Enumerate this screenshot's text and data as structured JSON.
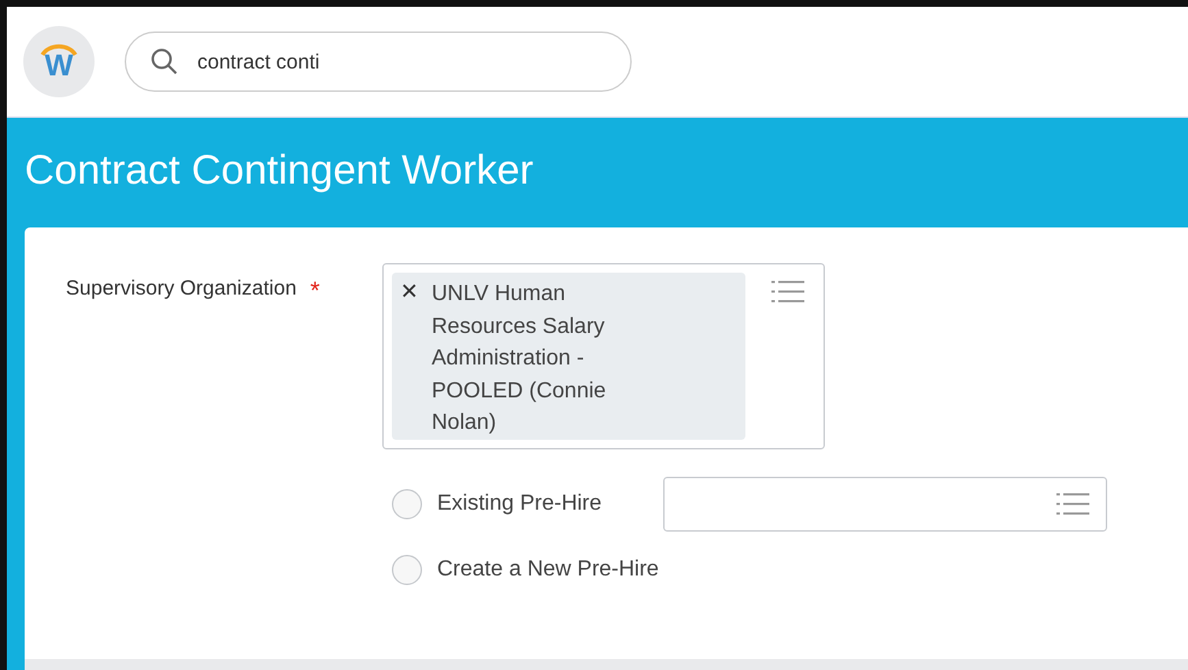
{
  "logo": {
    "text": "W"
  },
  "search": {
    "value": "contract conti"
  },
  "page_title": "Contract Contingent Worker",
  "supervisory_organization": {
    "label": "Supervisory Organization",
    "required": true,
    "required_mark": "*",
    "remove_symbol": "✕",
    "selection": "UNLV Human Resources Salary Administration - POOLED (Connie Nolan)"
  },
  "pre_hire_options": [
    {
      "label": "Existing Pre-Hire",
      "selected": false,
      "has_field": true
    },
    {
      "label": "Create a New Pre-Hire",
      "selected": false,
      "has_field": false
    }
  ]
}
